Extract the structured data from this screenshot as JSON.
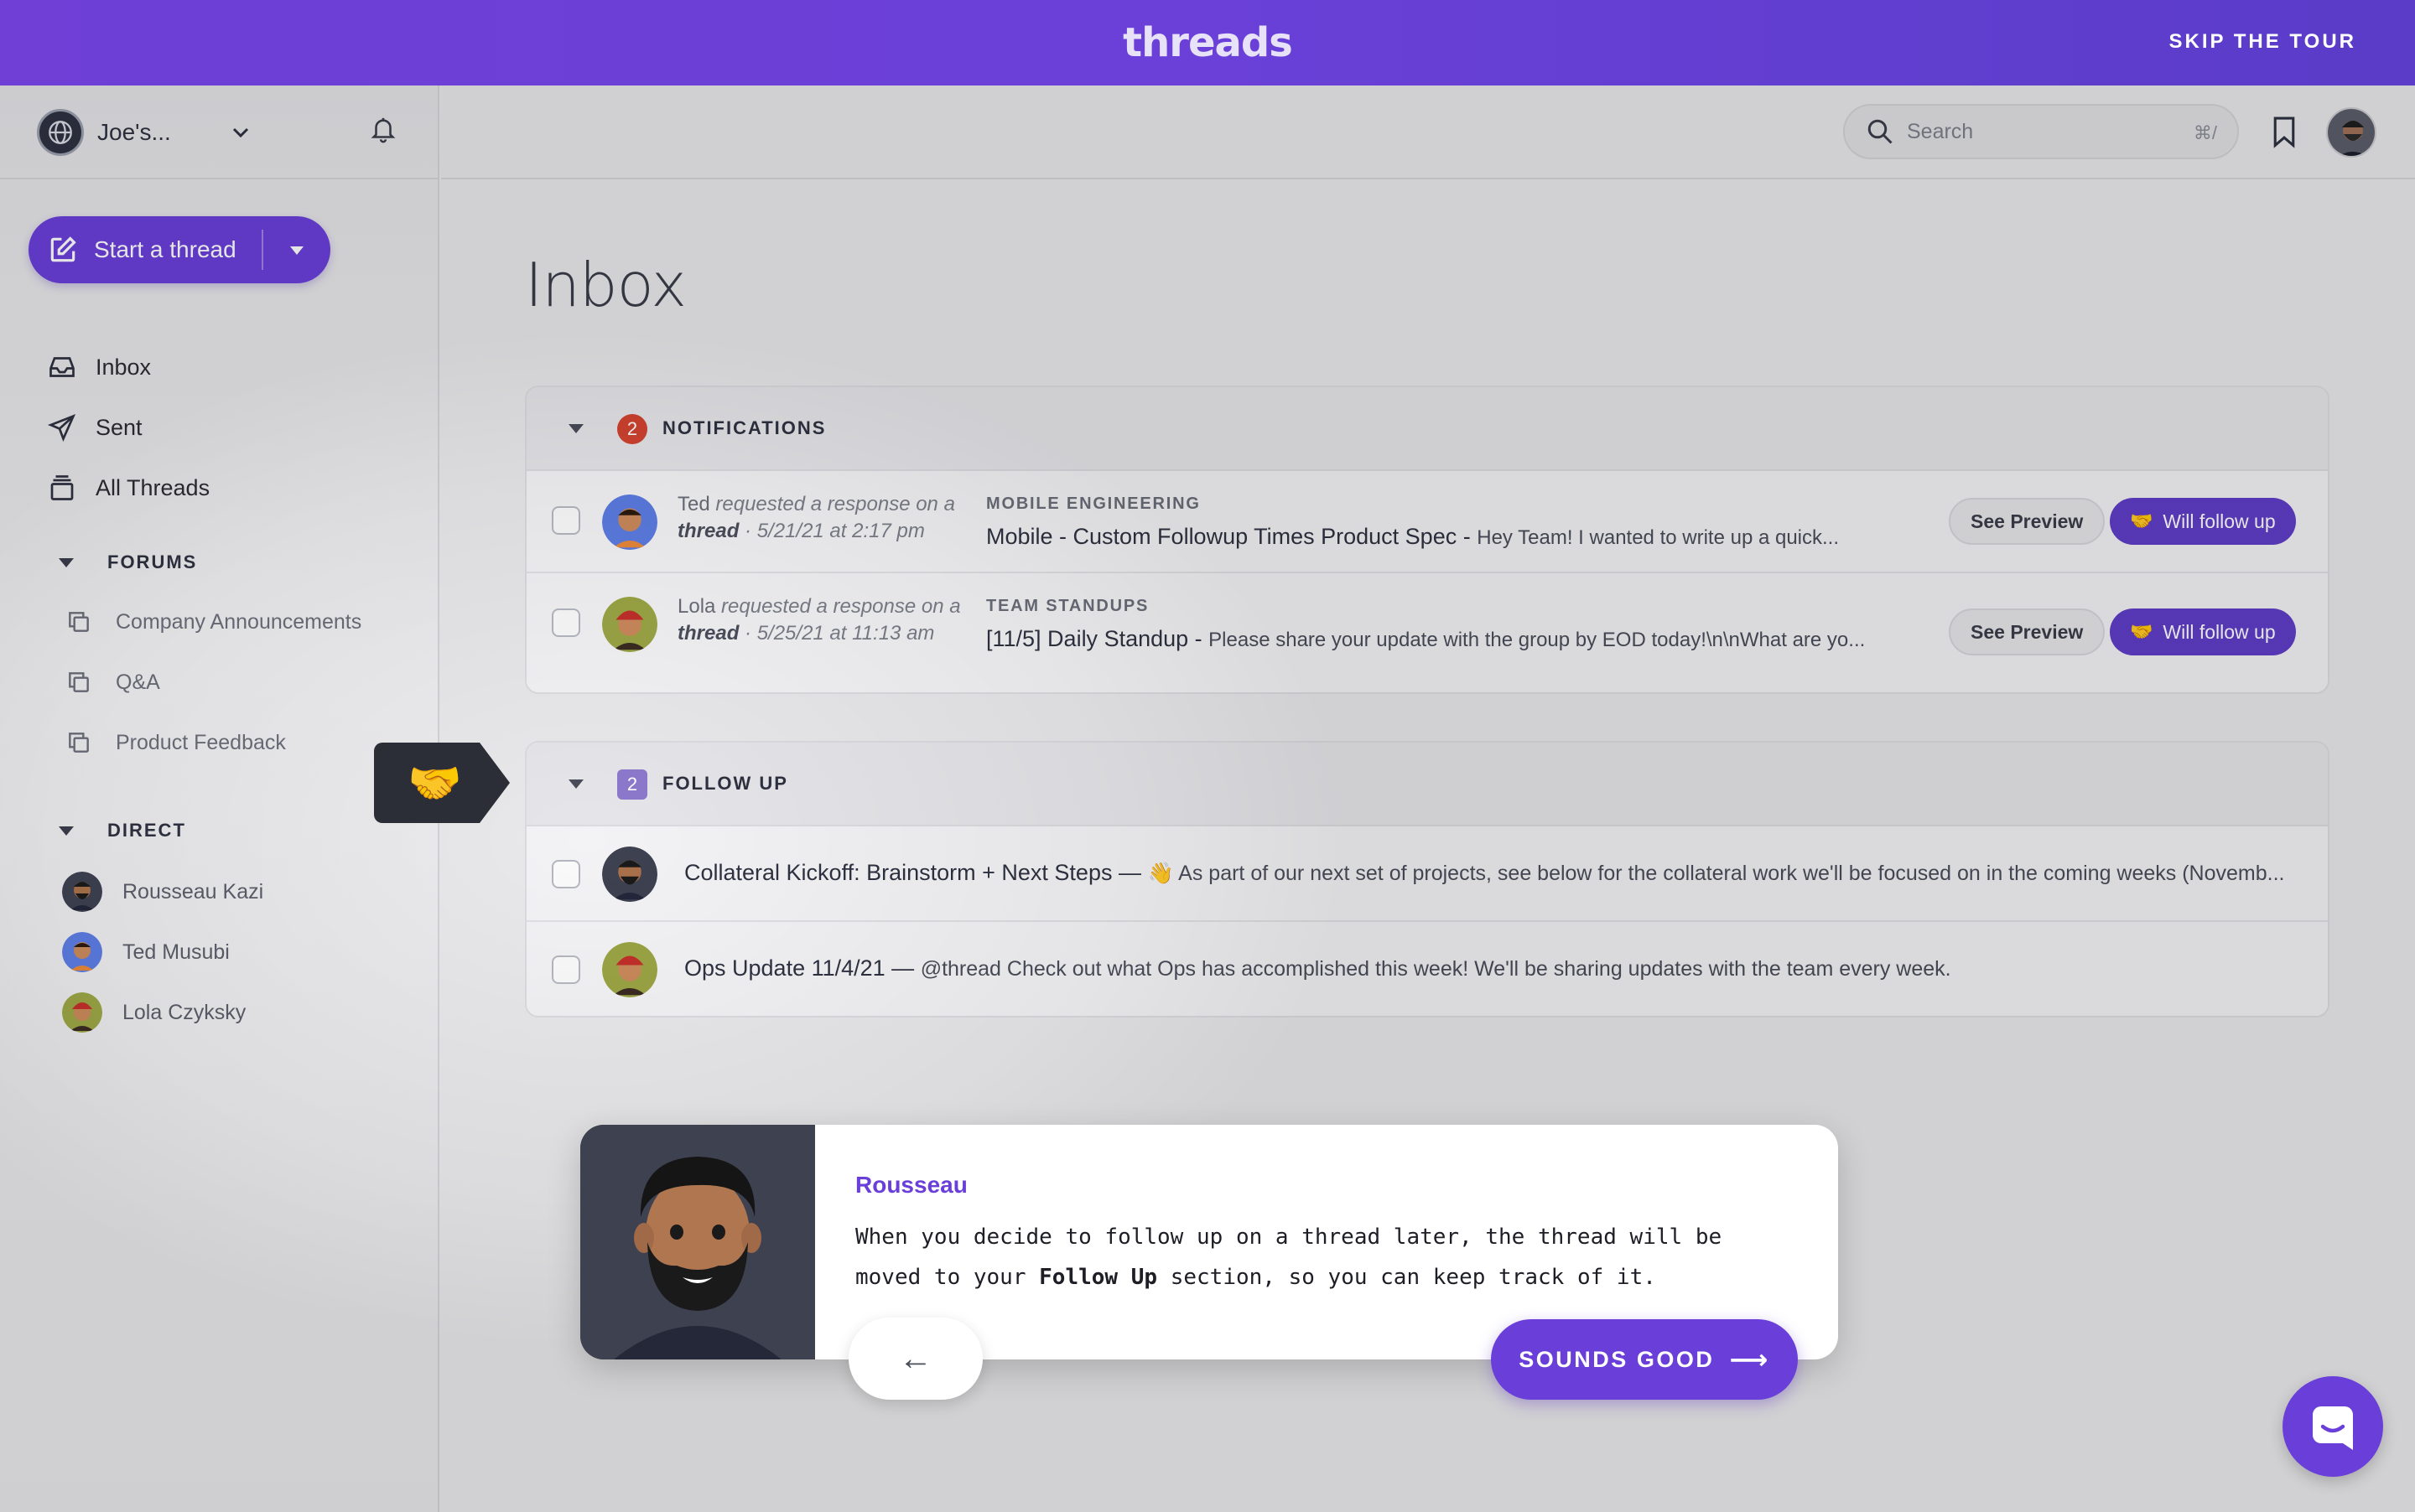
{
  "banner": {
    "logo": "threads",
    "skip_label": "SKIP THE TOUR"
  },
  "workspace": {
    "name": "Joe's...",
    "globe_icon": "globe-icon",
    "caret_icon": "chevron-down-icon",
    "bell_icon": "bell-icon"
  },
  "sidebar": {
    "start_thread_label": "Start a thread",
    "nav": [
      {
        "label": "Inbox",
        "icon": "inbox-icon"
      },
      {
        "label": "Sent",
        "icon": "send-icon"
      },
      {
        "label": "All Threads",
        "icon": "stack-icon"
      }
    ],
    "forums_header": "FORUMS",
    "forums": [
      "Company Announcements",
      "Q&A",
      "Product Feedback"
    ],
    "direct_header": "DIRECT",
    "direct": [
      "Rousseau Kazi",
      "Ted Musubi",
      "Lola Czyksky"
    ]
  },
  "search": {
    "placeholder": "Search",
    "shortcut": "⌘/"
  },
  "main": {
    "title": "Inbox",
    "notifications": {
      "header": "NOTIFICATIONS",
      "count": "2",
      "rows": [
        {
          "who": "Ted",
          "action": "requested a response on",
          "a_text": "a",
          "thread_word": "thread",
          "when": "· 5/21/21 at 2:17 pm",
          "forum": "MOBILE ENGINEERING",
          "title": "Mobile - Custom Followup Times Product Spec -",
          "preview": "Hey Team! I wanted to write up a quick...",
          "see_label": "See Preview",
          "follow_label": "Will follow up"
        },
        {
          "who": "Lola",
          "action": "requested a response on",
          "a_text": "a",
          "thread_word": "thread",
          "when": "· 5/25/21 at 11:13 am",
          "forum": "TEAM STANDUPS",
          "title": "[11/5] Daily Standup -",
          "preview": "Please share your update with the group by EOD today!\\n\\nWhat are yo...",
          "see_label": "See Preview",
          "follow_label": "Will follow up"
        }
      ]
    },
    "follow_up": {
      "header": "FOLLOW UP",
      "count": "2",
      "rows": [
        {
          "title": "Collateral Kickoff: Brainstorm + Next Steps —",
          "preview": "👋 As part of our next set of projects, see below for the collateral work we'll be focused on in the coming weeks (Novemb..."
        },
        {
          "title": "Ops Update 11/4/21 —",
          "preview": "@thread Check out what Ops has accomplished this week! We'll be sharing updates with the team every week."
        }
      ]
    }
  },
  "tour": {
    "name": "Rousseau",
    "msg_part1": "When you decide to follow up on a thread later, the thread will be moved to your",
    "msg_bold": "Follow Up",
    "msg_part2": "section, so you can keep track of it.",
    "back_label": "←",
    "next_label": "SOUNDS GOOD",
    "next_arrow": "⟶"
  },
  "colors": {
    "accent": "#6a3fd9",
    "badge_red": "#d2432f",
    "follow_purple": "#5f3dc8"
  }
}
